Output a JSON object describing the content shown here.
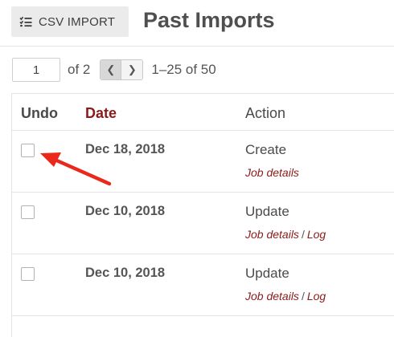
{
  "header": {
    "csv_button_label": "CSV IMPORT",
    "csv_icon": "list-check-icon",
    "title": "Past Imports"
  },
  "pager": {
    "current_page": "1",
    "of_text": "of 2",
    "prev_icon": "chevron-left-icon",
    "next_icon": "chevron-right-icon",
    "range_text": "1–25 of 50"
  },
  "table": {
    "headers": {
      "undo": "Undo",
      "date": "Date",
      "action": "Action"
    },
    "rows": [
      {
        "date": "Dec 18, 2018",
        "action": "Create",
        "job_details": "Job details",
        "separator": "",
        "log": ""
      },
      {
        "date": "Dec 10, 2018",
        "action": "Update",
        "job_details": "Job details",
        "separator": "/",
        "log": "Log"
      },
      {
        "date": "Dec 10, 2018",
        "action": "Update",
        "job_details": "Job details",
        "separator": "/",
        "log": "Log"
      }
    ]
  },
  "colors": {
    "accent": "#8b1a1a",
    "annotation_arrow": "#e8291c",
    "button_bg": "#ebebeb",
    "border": "#e4e4e4"
  },
  "annotation": {
    "icon": "red-arrow-pointer"
  }
}
